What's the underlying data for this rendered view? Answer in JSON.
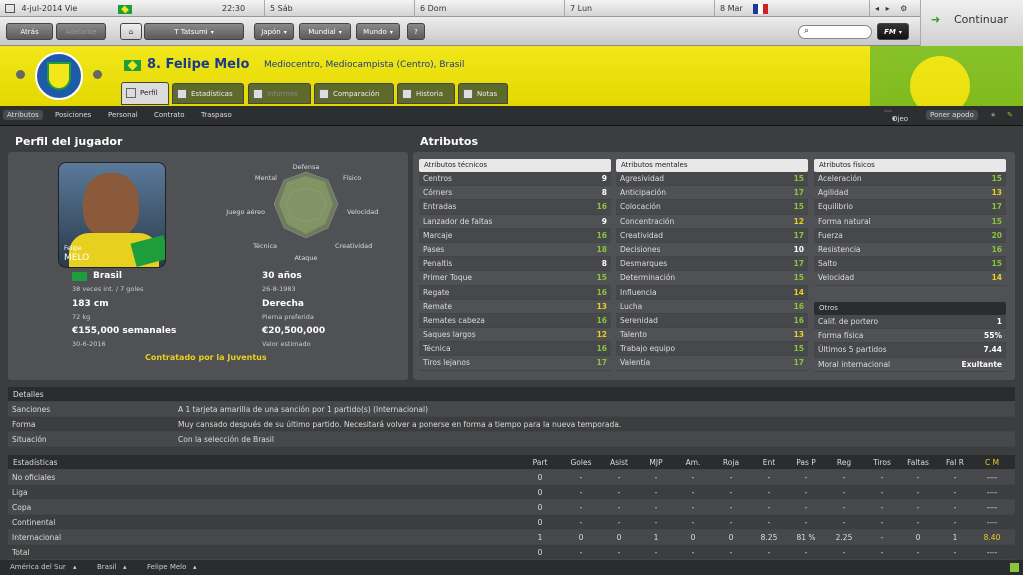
{
  "topbar": {
    "date": "4-jul-2014 Vie",
    "time": "22:30",
    "days": [
      "5 Sáb",
      "6 Dom",
      "7 Lun",
      "8 Mar"
    ],
    "nav_prev": "◂",
    "nav_next": "▸",
    "settings": "⚙"
  },
  "nav": {
    "back": "Atrás",
    "forward": "Adelante",
    "team": "T Tatsumi",
    "japan": "Japón",
    "world_cup": "Mundial",
    "world": "Mundo",
    "help": "?",
    "fm": "FM",
    "continue": "Continuar"
  },
  "player": {
    "number_name": "8. Felipe Melo",
    "position": "Mediocentro, Mediocampista (Centro), Brasil"
  },
  "tabs": [
    "Perfil",
    "Estadísticas",
    "Informes",
    "Comparación",
    "Historia",
    "Notas"
  ],
  "subnav": {
    "items": [
      "Atributos",
      "Posiciones",
      "Personal",
      "Contrato",
      "Traspaso"
    ],
    "scout": "Ojeo",
    "bookmark": "Poner apodo"
  },
  "profile": {
    "title": "Perfil del jugador",
    "photo_first": "Felipe",
    "photo_last": "MELO",
    "radar_labels": [
      "Defensa",
      "Físico",
      "Velocidad",
      "Creatividad",
      "Ataque",
      "Técnica",
      "Juego aéreo",
      "Mental"
    ],
    "nation": "Brasil",
    "caps": "38 veces int. / 7 goles",
    "age": "30 años",
    "dob": "26-8-1983",
    "height": "183 cm",
    "weight": "72 kg",
    "foot": "Derecha",
    "foot_label": "Pierna preferida",
    "wage": "€155,000 semanales",
    "contract_end": "30-6-2016",
    "value": "€20,500,000",
    "value_label": "Valor estimado",
    "status": "Contratado por la Juventus"
  },
  "attributes": {
    "title": "Atributos",
    "technical": {
      "head": "Atributos técnicos",
      "rows": [
        [
          "Centros",
          "9"
        ],
        [
          "Córners",
          "8"
        ],
        [
          "Entradas",
          "16"
        ],
        [
          "Lanzador de faltas",
          "9"
        ],
        [
          "Marcaje",
          "16"
        ],
        [
          "Pases",
          "18"
        ],
        [
          "Penaltis",
          "8"
        ],
        [
          "Primer Toque",
          "15"
        ],
        [
          "Regate",
          "16"
        ],
        [
          "Remate",
          "13"
        ],
        [
          "Remates cabeza",
          "16"
        ],
        [
          "Saques largos",
          "12"
        ],
        [
          "Técnica",
          "16"
        ],
        [
          "Tiros lejanos",
          "17"
        ]
      ]
    },
    "mental": {
      "head": "Atributos mentales",
      "rows": [
        [
          "Agresividad",
          "15"
        ],
        [
          "Anticipación",
          "17"
        ],
        [
          "Colocación",
          "15"
        ],
        [
          "Concentración",
          "12"
        ],
        [
          "Creatividad",
          "17"
        ],
        [
          "Decisiones",
          "10"
        ],
        [
          "Desmarques",
          "17"
        ],
        [
          "Determinación",
          "15"
        ],
        [
          "Influencia",
          "14"
        ],
        [
          "Lucha",
          "16"
        ],
        [
          "Serenidad",
          "16"
        ],
        [
          "Talento",
          "13"
        ],
        [
          "Trabajo equipo",
          "15"
        ],
        [
          "Valentía",
          "17"
        ]
      ]
    },
    "physical": {
      "head": "Atributos físicos",
      "rows": [
        [
          "Aceleración",
          "15"
        ],
        [
          "Agilidad",
          "13"
        ],
        [
          "Equilibrio",
          "17"
        ],
        [
          "Forma natural",
          "15"
        ],
        [
          "Fuerza",
          "20"
        ],
        [
          "Resistencia",
          "16"
        ],
        [
          "Salto",
          "15"
        ],
        [
          "Velocidad",
          "14"
        ]
      ]
    },
    "other": {
      "head": "Otros",
      "rows": [
        [
          "Calif. de portero",
          "1"
        ],
        [
          "Forma física",
          "55%"
        ],
        [
          "Últimos 5 partidos",
          "7.44"
        ],
        [
          "Moral internacional",
          "Exultante"
        ]
      ]
    }
  },
  "details": {
    "head": "Detalles",
    "rows": [
      [
        "Sanciones",
        "A 1 tarjeta amarilla de una sanción por 1 partido(s) (Internacional)"
      ],
      [
        "Forma",
        "Muy cansado después de su último partido. Necesitará volver a ponerse en forma a tiempo para la nueva temporada."
      ],
      [
        "Situación",
        "Con la selección de Brasil"
      ]
    ]
  },
  "stats": {
    "head": "Estadísticas",
    "columns": [
      "Part",
      "Goles",
      "Asist",
      "MJP",
      "Am.",
      "Roja",
      "Ent",
      "Pas P",
      "Reg",
      "Tiros",
      "Faltas",
      "Fal R",
      "C M"
    ],
    "rows": [
      {
        "label": "No oficiales",
        "values": [
          "0",
          "-",
          "-",
          "-",
          "-",
          "-",
          "-",
          "-",
          "-",
          "-",
          "-",
          "-",
          "----"
        ]
      },
      {
        "label": "Liga",
        "values": [
          "0",
          "-",
          "-",
          "-",
          "-",
          "-",
          "-",
          "-",
          "-",
          "-",
          "-",
          "-",
          "----"
        ]
      },
      {
        "label": "Copa",
        "values": [
          "0",
          "-",
          "-",
          "-",
          "-",
          "-",
          "-",
          "-",
          "-",
          "-",
          "-",
          "-",
          "----"
        ]
      },
      {
        "label": "Continental",
        "values": [
          "0",
          "-",
          "-",
          "-",
          "-",
          "-",
          "-",
          "-",
          "-",
          "-",
          "-",
          "-",
          "----"
        ]
      },
      {
        "label": "Internacional",
        "values": [
          "1",
          "0",
          "0",
          "1",
          "0",
          "0",
          "8.25",
          "81 %",
          "2.25",
          "-",
          "0",
          "1",
          "8.40"
        ]
      },
      {
        "label": "Total",
        "values": [
          "0",
          "-",
          "-",
          "-",
          "-",
          "-",
          "-",
          "-",
          "-",
          "-",
          "-",
          "-",
          "----"
        ]
      }
    ]
  },
  "footer": [
    "América del Sur",
    "Brasil",
    "Felipe Melo"
  ],
  "colors": {
    "header_yellow": "#f1e71a",
    "brazil_green": "#1e9e3a",
    "brazil_blue": "#1a3a8a",
    "highlight_green": "#8ac53a",
    "highlight_yellow": "#e8d020"
  }
}
